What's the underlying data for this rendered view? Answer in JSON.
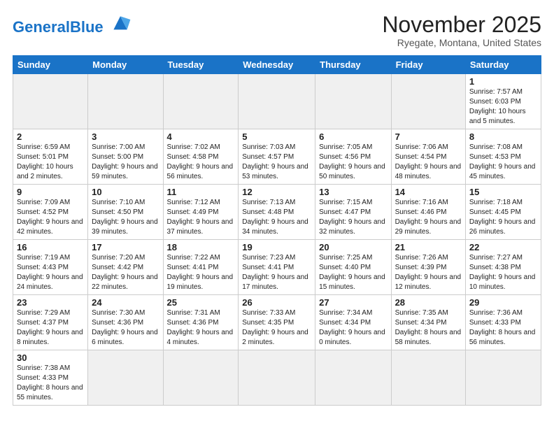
{
  "header": {
    "logo_general": "General",
    "logo_blue": "Blue",
    "month_title": "November 2025",
    "location": "Ryegate, Montana, United States"
  },
  "weekdays": [
    "Sunday",
    "Monday",
    "Tuesday",
    "Wednesday",
    "Thursday",
    "Friday",
    "Saturday"
  ],
  "weeks": [
    [
      {
        "day": "",
        "info": ""
      },
      {
        "day": "",
        "info": ""
      },
      {
        "day": "",
        "info": ""
      },
      {
        "day": "",
        "info": ""
      },
      {
        "day": "",
        "info": ""
      },
      {
        "day": "",
        "info": ""
      },
      {
        "day": "1",
        "info": "Sunrise: 7:57 AM\nSunset: 6:03 PM\nDaylight: 10 hours and 5 minutes."
      }
    ],
    [
      {
        "day": "2",
        "info": "Sunrise: 6:59 AM\nSunset: 5:01 PM\nDaylight: 10 hours and 2 minutes."
      },
      {
        "day": "3",
        "info": "Sunrise: 7:00 AM\nSunset: 5:00 PM\nDaylight: 9 hours and 59 minutes."
      },
      {
        "day": "4",
        "info": "Sunrise: 7:02 AM\nSunset: 4:58 PM\nDaylight: 9 hours and 56 minutes."
      },
      {
        "day": "5",
        "info": "Sunrise: 7:03 AM\nSunset: 4:57 PM\nDaylight: 9 hours and 53 minutes."
      },
      {
        "day": "6",
        "info": "Sunrise: 7:05 AM\nSunset: 4:56 PM\nDaylight: 9 hours and 50 minutes."
      },
      {
        "day": "7",
        "info": "Sunrise: 7:06 AM\nSunset: 4:54 PM\nDaylight: 9 hours and 48 minutes."
      },
      {
        "day": "8",
        "info": "Sunrise: 7:08 AM\nSunset: 4:53 PM\nDaylight: 9 hours and 45 minutes."
      }
    ],
    [
      {
        "day": "9",
        "info": "Sunrise: 7:09 AM\nSunset: 4:52 PM\nDaylight: 9 hours and 42 minutes."
      },
      {
        "day": "10",
        "info": "Sunrise: 7:10 AM\nSunset: 4:50 PM\nDaylight: 9 hours and 39 minutes."
      },
      {
        "day": "11",
        "info": "Sunrise: 7:12 AM\nSunset: 4:49 PM\nDaylight: 9 hours and 37 minutes."
      },
      {
        "day": "12",
        "info": "Sunrise: 7:13 AM\nSunset: 4:48 PM\nDaylight: 9 hours and 34 minutes."
      },
      {
        "day": "13",
        "info": "Sunrise: 7:15 AM\nSunset: 4:47 PM\nDaylight: 9 hours and 32 minutes."
      },
      {
        "day": "14",
        "info": "Sunrise: 7:16 AM\nSunset: 4:46 PM\nDaylight: 9 hours and 29 minutes."
      },
      {
        "day": "15",
        "info": "Sunrise: 7:18 AM\nSunset: 4:45 PM\nDaylight: 9 hours and 26 minutes."
      }
    ],
    [
      {
        "day": "16",
        "info": "Sunrise: 7:19 AM\nSunset: 4:43 PM\nDaylight: 9 hours and 24 minutes."
      },
      {
        "day": "17",
        "info": "Sunrise: 7:20 AM\nSunset: 4:42 PM\nDaylight: 9 hours and 22 minutes."
      },
      {
        "day": "18",
        "info": "Sunrise: 7:22 AM\nSunset: 4:41 PM\nDaylight: 9 hours and 19 minutes."
      },
      {
        "day": "19",
        "info": "Sunrise: 7:23 AM\nSunset: 4:41 PM\nDaylight: 9 hours and 17 minutes."
      },
      {
        "day": "20",
        "info": "Sunrise: 7:25 AM\nSunset: 4:40 PM\nDaylight: 9 hours and 15 minutes."
      },
      {
        "day": "21",
        "info": "Sunrise: 7:26 AM\nSunset: 4:39 PM\nDaylight: 9 hours and 12 minutes."
      },
      {
        "day": "22",
        "info": "Sunrise: 7:27 AM\nSunset: 4:38 PM\nDaylight: 9 hours and 10 minutes."
      }
    ],
    [
      {
        "day": "23",
        "info": "Sunrise: 7:29 AM\nSunset: 4:37 PM\nDaylight: 9 hours and 8 minutes."
      },
      {
        "day": "24",
        "info": "Sunrise: 7:30 AM\nSunset: 4:36 PM\nDaylight: 9 hours and 6 minutes."
      },
      {
        "day": "25",
        "info": "Sunrise: 7:31 AM\nSunset: 4:36 PM\nDaylight: 9 hours and 4 minutes."
      },
      {
        "day": "26",
        "info": "Sunrise: 7:33 AM\nSunset: 4:35 PM\nDaylight: 9 hours and 2 minutes."
      },
      {
        "day": "27",
        "info": "Sunrise: 7:34 AM\nSunset: 4:34 PM\nDaylight: 9 hours and 0 minutes."
      },
      {
        "day": "28",
        "info": "Sunrise: 7:35 AM\nSunset: 4:34 PM\nDaylight: 8 hours and 58 minutes."
      },
      {
        "day": "29",
        "info": "Sunrise: 7:36 AM\nSunset: 4:33 PM\nDaylight: 8 hours and 56 minutes."
      }
    ],
    [
      {
        "day": "30",
        "info": "Sunrise: 7:38 AM\nSunset: 4:33 PM\nDaylight: 8 hours and 55 minutes."
      },
      {
        "day": "",
        "info": ""
      },
      {
        "day": "",
        "info": ""
      },
      {
        "day": "",
        "info": ""
      },
      {
        "day": "",
        "info": ""
      },
      {
        "day": "",
        "info": ""
      },
      {
        "day": "",
        "info": ""
      }
    ]
  ]
}
